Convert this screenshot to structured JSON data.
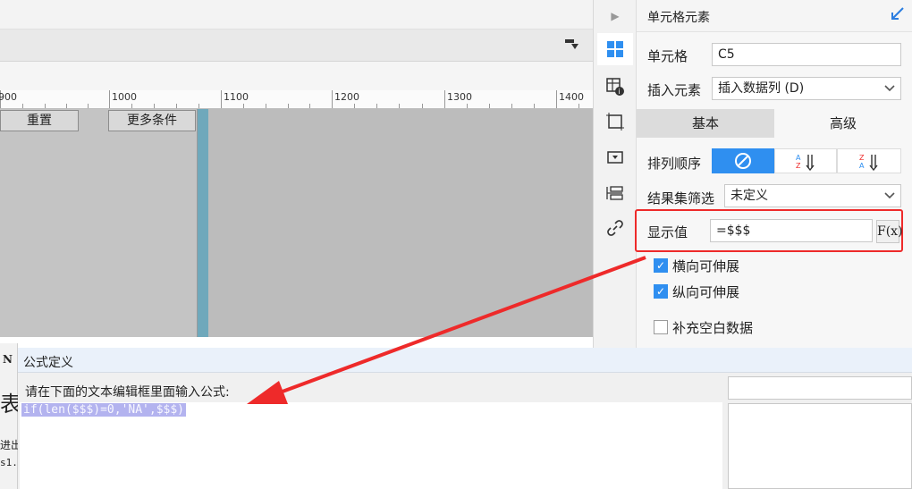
{
  "designer": {
    "ruler_labels": [
      "900",
      "1000",
      "1100",
      "1200",
      "1300",
      "1400"
    ],
    "reset_button": "重置",
    "more_conditions_button": "更多条件"
  },
  "side_icons": [
    "cell-element-icon",
    "cell-attribute-icon",
    "cell-style-icon",
    "widget-icon",
    "condition-icon",
    "hyperlink-icon"
  ],
  "panel": {
    "title": "单元格元素",
    "cell_label": "单元格",
    "cell_value": "C5",
    "insert_label": "插入元素",
    "insert_value": "插入数据列 (D)",
    "tab_basic": "基本",
    "tab_advanced": "高级",
    "sort_label": "排列顺序",
    "filter_label": "结果集筛选",
    "filter_value": "未定义",
    "display_label": "显示值",
    "display_value": "=$$$",
    "fx_label": "F(x)",
    "checkboxes": [
      {
        "label": "横向可伸展",
        "checked": true
      },
      {
        "label": "纵向可伸展",
        "checked": true
      },
      {
        "label": "补充空白数据",
        "checked": false
      }
    ],
    "highlight_color": "#ee2a2a",
    "accent_color": "#2f8ff0"
  },
  "dialog": {
    "title": "公式定义",
    "prompt": "请在下面的文本编辑框里面输入公式:",
    "formula": "if(len($$$)=0,'NA',$$$)"
  },
  "background_fragments": {
    "n": "N",
    "biao": "表",
    "jin": "进出",
    "s1": "s1."
  }
}
